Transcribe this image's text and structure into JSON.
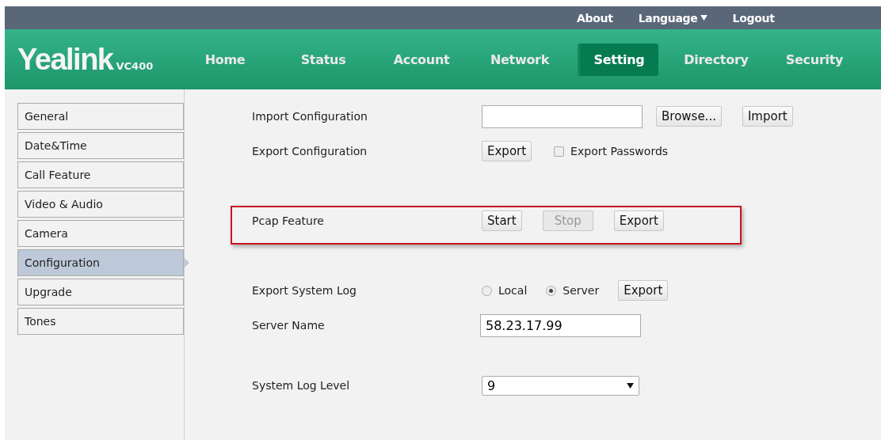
{
  "top_links": [
    {
      "label": "About",
      "kind": "link"
    },
    {
      "label": "Language",
      "kind": "dropdown"
    },
    {
      "label": "Logout",
      "kind": "link"
    }
  ],
  "logo": {
    "brand": "Yealink",
    "model": "VC400"
  },
  "nav": [
    {
      "label": "Home",
      "selected": false
    },
    {
      "label": "Status",
      "selected": false
    },
    {
      "label": "Account",
      "selected": false
    },
    {
      "label": "Network",
      "selected": false
    },
    {
      "label": "Setting",
      "selected": true
    },
    {
      "label": "Directory",
      "selected": false
    },
    {
      "label": "Security",
      "selected": false
    }
  ],
  "sidebar": [
    {
      "label": "General",
      "selected": false
    },
    {
      "label": "Date&Time",
      "selected": false
    },
    {
      "label": "Call Feature",
      "selected": false
    },
    {
      "label": "Video & Audio",
      "selected": false
    },
    {
      "label": "Camera",
      "selected": false
    },
    {
      "label": "Configuration",
      "selected": true
    },
    {
      "label": "Upgrade",
      "selected": false
    },
    {
      "label": "Tones",
      "selected": false
    }
  ],
  "sections": [
    {
      "highlighted": false,
      "rows": [
        {
          "kind": "file",
          "label": "Import Configuration",
          "buttons": [
            {
              "label": "Browse...",
              "disabled": false
            },
            {
              "label": "Import",
              "disabled": false
            }
          ]
        },
        {
          "kind": "export",
          "label": "Export Configuration",
          "buttons": [
            {
              "label": "Export",
              "disabled": false
            }
          ],
          "checkbox": {
            "label": "Export Passwords",
            "checked": false
          }
        }
      ]
    },
    {
      "highlighted": true,
      "rows": [
        {
          "kind": "buttons",
          "label": "Pcap Feature",
          "buttons": [
            {
              "label": "Start",
              "disabled": false
            },
            {
              "label": "Stop",
              "disabled": true
            },
            {
              "label": "Export",
              "disabled": false
            }
          ]
        }
      ]
    },
    {
      "highlighted": false,
      "rows": [
        {
          "kind": "radio",
          "label": "Export System Log",
          "options": [
            {
              "label": "Local",
              "selected": false
            },
            {
              "label": "Server",
              "selected": true
            }
          ],
          "buttons": [
            {
              "label": "Export",
              "disabled": false
            }
          ]
        },
        {
          "kind": "text",
          "label": "Server Name",
          "value": "58.23.17.99"
        }
      ]
    },
    {
      "highlighted": false,
      "rows": [
        {
          "kind": "select",
          "label": "System Log Level",
          "value": "9"
        }
      ]
    }
  ]
}
